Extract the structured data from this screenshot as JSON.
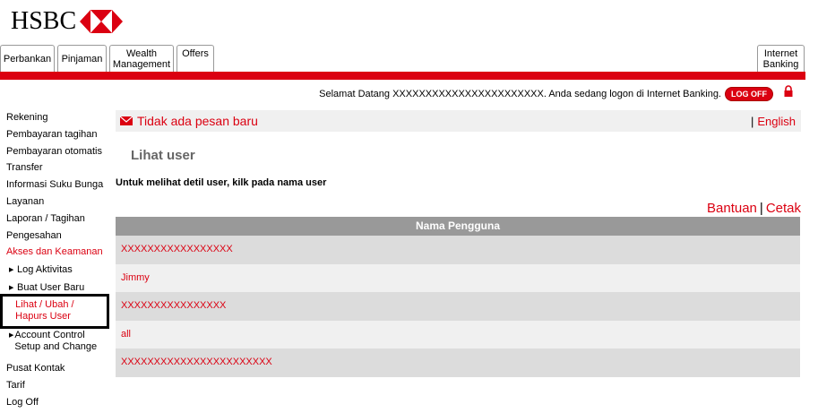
{
  "brand": {
    "name": "HSBC",
    "accent": "#db0011"
  },
  "tabs": [
    {
      "label": "Perbankan"
    },
    {
      "label": "Pinjaman"
    },
    {
      "label": "Wealth Management"
    },
    {
      "label": "Offers"
    },
    {
      "label": "Internet Banking"
    }
  ],
  "header": {
    "welcome_text": "Selamat Datang XXXXXXXXXXXXXXXXXXXXXXX. Anda sedang logon di Internet Banking.",
    "logoff_label": "LOG OFF"
  },
  "sidebar": {
    "items": [
      {
        "label": "Rekening"
      },
      {
        "label": "Pembayaran tagihan"
      },
      {
        "label": "Pembayaran otomatis"
      },
      {
        "label": "Transfer"
      },
      {
        "label": "Informasi Suku Bunga"
      },
      {
        "label": "Layanan"
      },
      {
        "label": "Laporan / Tagihan"
      },
      {
        "label": "Pengesahan"
      },
      {
        "label": "Akses dan Keamanan"
      }
    ],
    "subitems": [
      {
        "label": "Log Aktivitas"
      },
      {
        "label": "Buat User Baru"
      },
      {
        "label": "Lihat / Ubah / Hapurs User"
      },
      {
        "label": "Account Control Setup and Change"
      }
    ],
    "bottom_items": [
      {
        "label": "Pusat Kontak"
      },
      {
        "label": "Tarif"
      },
      {
        "label": "Log Off"
      }
    ]
  },
  "message_bar": {
    "text": "Tidak ada pesan baru",
    "separator": "|",
    "language": "English"
  },
  "page": {
    "title": "Lihat user",
    "instruction": "Untuk melihat detil user, kilk pada nama user",
    "help_label": "Bantuan",
    "link_separator": "|",
    "print_label": "Cetak"
  },
  "table": {
    "header": "Nama Pengguna",
    "rows": [
      "XXXXXXXXXXXXXXXXX",
      "Jimmy",
      "XXXXXXXXXXXXXXXX",
      "all",
      "XXXXXXXXXXXXXXXXXXXXXXX"
    ]
  }
}
